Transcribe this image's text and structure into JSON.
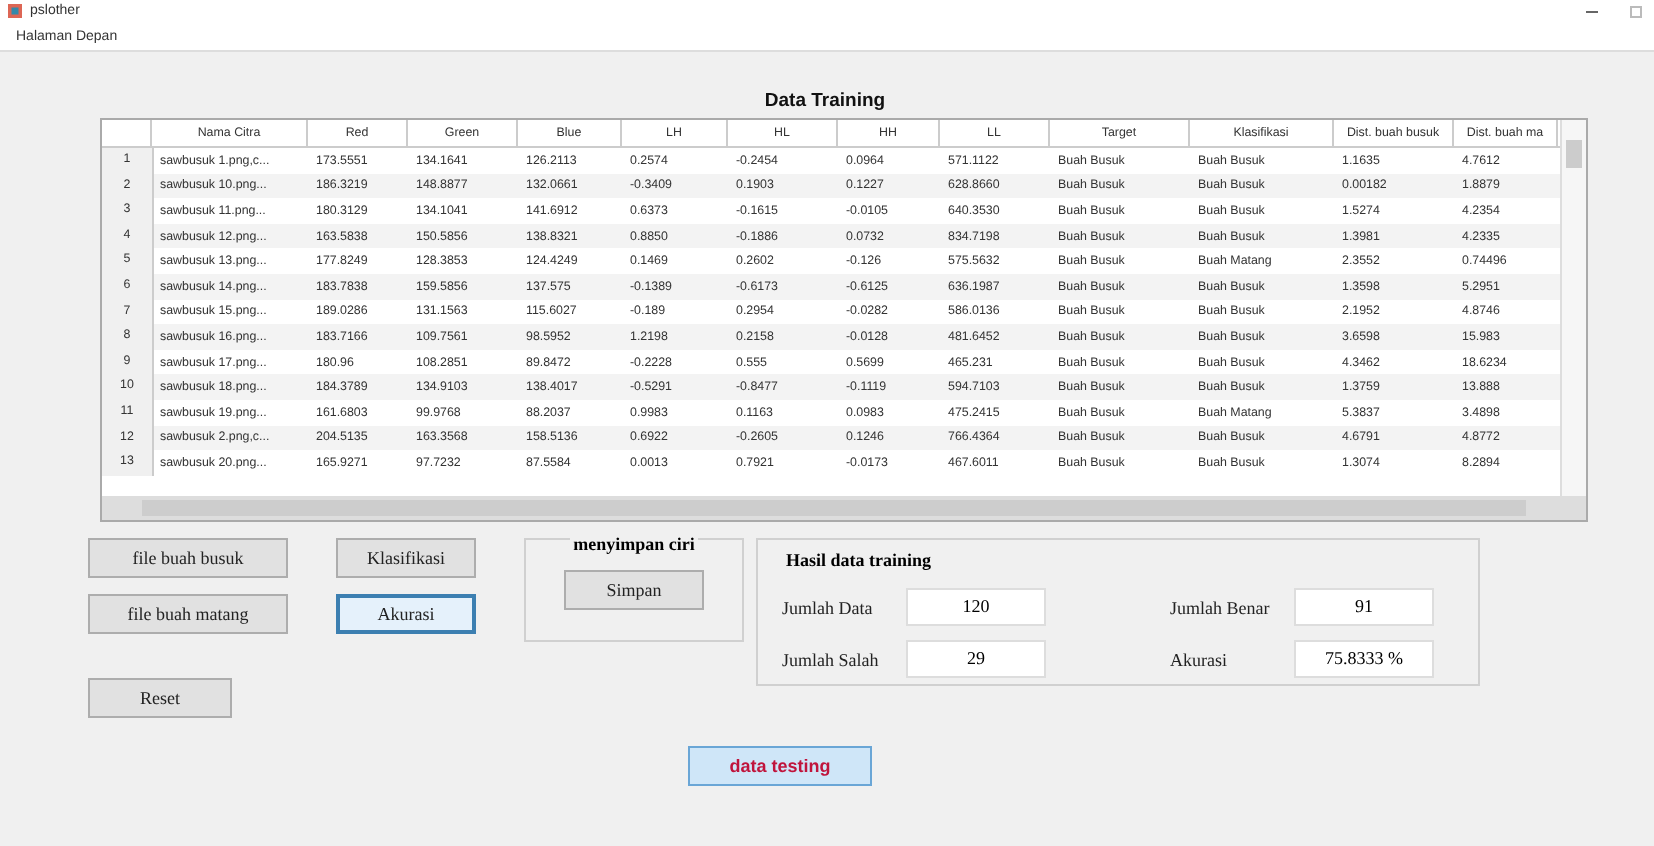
{
  "window": {
    "title": "pslother"
  },
  "menu": [
    "Halaman Depan"
  ],
  "heading": "Data Training",
  "table": {
    "columns": [
      "Nama Citra",
      "Red",
      "Green",
      "Blue",
      "LH",
      "HL",
      "HH",
      "LL",
      "Target",
      "Klasifikasi",
      "Dist. buah busuk",
      "Dist. buah ma"
    ],
    "rows": [
      {
        "no": "1",
        "cells": [
          "sawbusuk 1.png,c...",
          "173.5551",
          "134.1641",
          "126.2113",
          "0.2574",
          "-0.2454",
          "0.0964",
          "571.1122",
          "Buah Busuk",
          "Buah Busuk",
          "1.1635",
          "4.7612"
        ]
      },
      {
        "no": "2",
        "cells": [
          "sawbusuk 10.png...",
          "186.3219",
          "148.8877",
          "132.0661",
          "-0.3409",
          "0.1903",
          "0.1227",
          "628.8660",
          "Buah Busuk",
          "Buah Busuk",
          "0.00182",
          "1.8879"
        ]
      },
      {
        "no": "3",
        "cells": [
          "sawbusuk 11.png...",
          "180.3129",
          "134.1041",
          "141.6912",
          "0.6373",
          "-0.1615",
          "-0.0105",
          "640.3530",
          "Buah Busuk",
          "Buah Busuk",
          "1.5274",
          "4.2354"
        ]
      },
      {
        "no": "4",
        "cells": [
          "sawbusuk 12.png...",
          "163.5838",
          "150.5856",
          "138.8321",
          "0.8850",
          "-0.1886",
          "0.0732",
          "834.7198",
          "Buah Busuk",
          "Buah Busuk",
          "1.3981",
          "4.2335"
        ]
      },
      {
        "no": "5",
        "cells": [
          "sawbusuk 13.png...",
          "177.8249",
          "128.3853",
          "124.4249",
          "0.1469",
          "0.2602",
          "-0.126",
          "575.5632",
          "Buah Busuk",
          "Buah Matang",
          "2.3552",
          "0.74496"
        ]
      },
      {
        "no": "6",
        "cells": [
          "sawbusuk 14.png...",
          "183.7838",
          "159.5856",
          "137.575",
          "-0.1389",
          "-0.6173",
          "-0.6125",
          "636.1987",
          "Buah Busuk",
          "Buah Busuk",
          "1.3598",
          "5.2951"
        ]
      },
      {
        "no": "7",
        "cells": [
          "sawbusuk 15.png...",
          "189.0286",
          "131.1563",
          "115.6027",
          "-0.189",
          "0.2954",
          "-0.0282",
          "586.0136",
          "Buah Busuk",
          "Buah Busuk",
          "2.1952",
          "4.8746"
        ]
      },
      {
        "no": "8",
        "cells": [
          "sawbusuk 16.png...",
          "183.7166",
          "109.7561",
          "98.5952",
          "1.2198",
          "0.2158",
          "-0.0128",
          "481.6452",
          "Buah Busuk",
          "Buah Busuk",
          "3.6598",
          "15.983"
        ]
      },
      {
        "no": "9",
        "cells": [
          "sawbusuk 17.png...",
          "180.96",
          "108.2851",
          "89.8472",
          "-0.2228",
          "0.555",
          "0.5699",
          "465.231",
          "Buah Busuk",
          "Buah Busuk",
          "4.3462",
          "18.6234"
        ]
      },
      {
        "no": "10",
        "cells": [
          "sawbusuk 18.png...",
          "184.3789",
          "134.9103",
          "138.4017",
          "-0.5291",
          "-0.8477",
          "-0.1119",
          "594.7103",
          "Buah Busuk",
          "Buah Busuk",
          "1.3759",
          "13.888"
        ]
      },
      {
        "no": "11",
        "cells": [
          "sawbusuk 19.png...",
          "161.6803",
          "99.9768",
          "88.2037",
          "0.9983",
          "0.1163",
          "0.0983",
          "475.2415",
          "Buah Busuk",
          "Buah Matang",
          "5.3837",
          "3.4898"
        ]
      },
      {
        "no": "12",
        "cells": [
          "sawbusuk 2.png,c...",
          "204.5135",
          "163.3568",
          "158.5136",
          "0.6922",
          "-0.2605",
          "0.1246",
          "766.4364",
          "Buah Busuk",
          "Buah Busuk",
          "4.6791",
          "4.8772"
        ]
      },
      {
        "no": "13",
        "cells": [
          "sawbusuk 20.png...",
          "165.9271",
          "97.7232",
          "87.5584",
          "0.0013",
          "0.7921",
          "-0.0173",
          "467.6011",
          "Buah Busuk",
          "Buah Busuk",
          "1.3074",
          "8.2894"
        ]
      }
    ]
  },
  "buttons": {
    "file_busuk": "file buah busuk",
    "file_matang": "file buah matang",
    "reset": "Reset",
    "klasifikasi": "Klasifikasi",
    "akurasi": "Akurasi",
    "data_testing": "data testing"
  },
  "save_panel": {
    "title": "menyimpan ciri",
    "button": "Simpan"
  },
  "results": {
    "title": "Hasil data training",
    "fields": [
      {
        "label": "Jumlah Data",
        "value": "120"
      },
      {
        "label": "Jumlah Benar",
        "value": "91"
      },
      {
        "label": "Jumlah Salah",
        "value": "29"
      },
      {
        "label": "Akurasi",
        "value": "75.8333 %"
      }
    ]
  }
}
